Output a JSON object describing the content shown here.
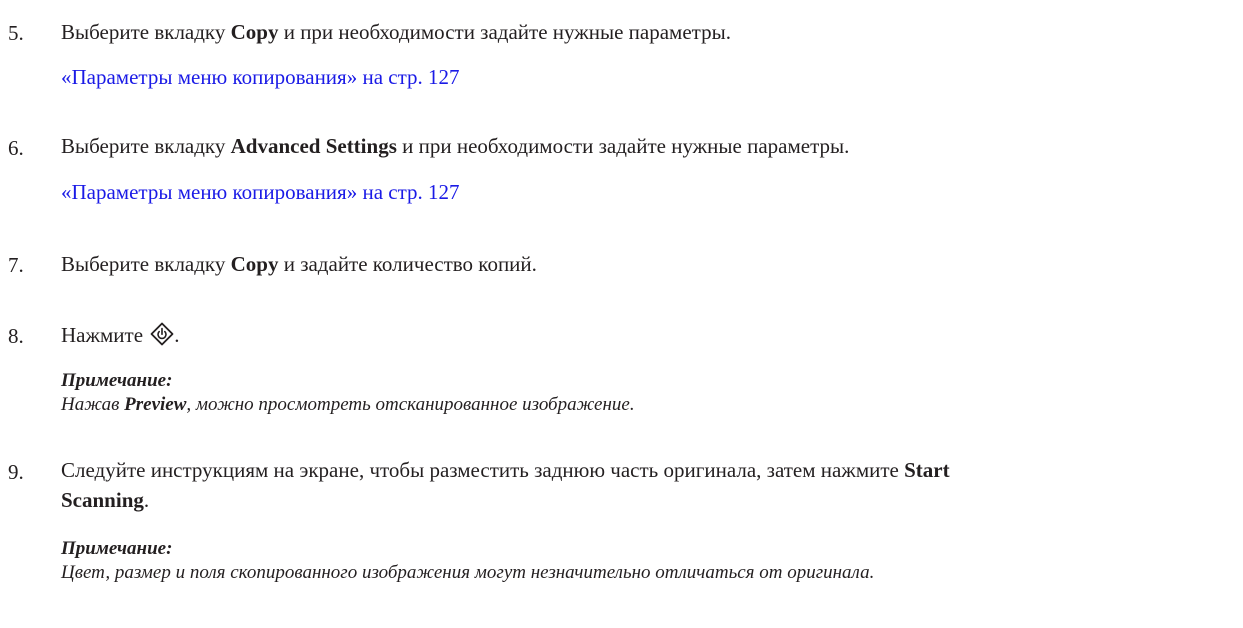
{
  "steps": [
    {
      "number": "5.",
      "pre": "Выберите вкладку ",
      "bold": "Copy",
      "post": " и при необходимости задайте нужные параметры.",
      "link": "«Параметры меню копирования» на стр. 127"
    },
    {
      "number": "6.",
      "pre": "Выберите вкладку ",
      "bold": "Advanced Settings",
      "post": " и при необходимости задайте нужные параметры.",
      "link": "«Параметры меню копирования» на стр. 127"
    },
    {
      "number": "7.",
      "pre": "Выберите вкладку ",
      "bold": "Copy",
      "post": " и задайте количество копий."
    },
    {
      "number": "8.",
      "pre": "Нажмите ",
      "icon": "start-button-icon",
      "post": ".",
      "note": {
        "title": "Примечание:",
        "pre": "Нажав ",
        "bold": "Preview",
        "post": ", можно просмотреть отсканированное изображение."
      }
    },
    {
      "number": "9.",
      "line1_pre": "Следуйте инструкциям на экране, чтобы разместить заднюю часть оригинала, затем нажмите ",
      "line1_bold": "Start",
      "line2_bold": "Scanning",
      "line2_post": ".",
      "note": {
        "title": "Примечание:",
        "body": "Цвет, размер и поля скопированного изображения могут незначительно отличаться от оригинала."
      }
    }
  ]
}
